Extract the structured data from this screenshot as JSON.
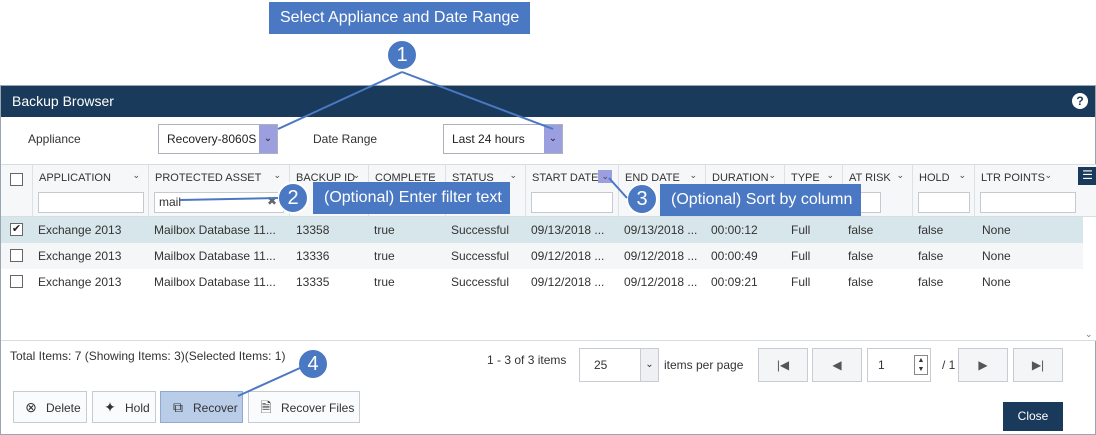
{
  "callouts": {
    "c1": {
      "num": "1",
      "text": "Select Appliance and Date Range"
    },
    "c2": {
      "num": "2",
      "text": "(Optional) Enter filter text"
    },
    "c3": {
      "num": "3",
      "text": "(Optional) Sort by column"
    },
    "c4": {
      "num": "4"
    }
  },
  "dialog": {
    "title": "Backup Browser",
    "help_icon": "?"
  },
  "filters": {
    "appliance_label": "Appliance",
    "appliance_value": "Recovery-8060S",
    "date_range_label": "Date Range",
    "date_range_value": "Last 24 hours"
  },
  "columns": [
    {
      "label": "APPLICATION"
    },
    {
      "label": "PROTECTED ASSET",
      "filter_value": "mail"
    },
    {
      "label": "BACKUP ID"
    },
    {
      "label": "COMPLETE"
    },
    {
      "label": "STATUS"
    },
    {
      "label": "START DATE"
    },
    {
      "label": "END DATE"
    },
    {
      "label": "DURATION"
    },
    {
      "label": "TYPE"
    },
    {
      "label": "AT RISK"
    },
    {
      "label": "HOLD"
    },
    {
      "label": "LTR POINTS"
    }
  ],
  "rows": [
    {
      "selected": true,
      "application": "Exchange 2013",
      "asset": "Mailbox Database 11...",
      "backup_id": "13358",
      "complete": "true",
      "status": "Successful",
      "start": "09/13/2018 ...",
      "end": "09/13/2018 ...",
      "duration": "00:00:12",
      "type": "Full",
      "at_risk": "false",
      "hold": "false",
      "ltr": "None"
    },
    {
      "selected": false,
      "application": "Exchange 2013",
      "asset": "Mailbox Database 11...",
      "backup_id": "13336",
      "complete": "true",
      "status": "Successful",
      "start": "09/12/2018 ...",
      "end": "09/12/2018 ...",
      "duration": "00:00:49",
      "type": "Full",
      "at_risk": "false",
      "hold": "false",
      "ltr": "None"
    },
    {
      "selected": false,
      "application": "Exchange 2013",
      "asset": "Mailbox Database 11...",
      "backup_id": "13335",
      "complete": "true",
      "status": "Successful",
      "start": "09/12/2018 ...",
      "end": "09/12/2018 ...",
      "duration": "00:09:21",
      "type": "Full",
      "at_risk": "false",
      "hold": "false",
      "ltr": "None"
    }
  ],
  "footer": {
    "totals": "Total Items: 7 (Showing Items: 3)(Selected Items: 1)",
    "range": "1 - 3 of 3 items",
    "per_page_value": "25",
    "per_page_label": "items per page",
    "page_value": "1",
    "page_total": "/ 1"
  },
  "actions": {
    "delete": "Delete",
    "hold": "Hold",
    "recover": "Recover",
    "recover_files": "Recover Files",
    "close": "Close"
  },
  "colors": {
    "title_bar": "#193a5a",
    "callout": "#4a78c2",
    "selected_row": "#d7e6ea",
    "dropdown_arrow": "#9b9fe0"
  }
}
